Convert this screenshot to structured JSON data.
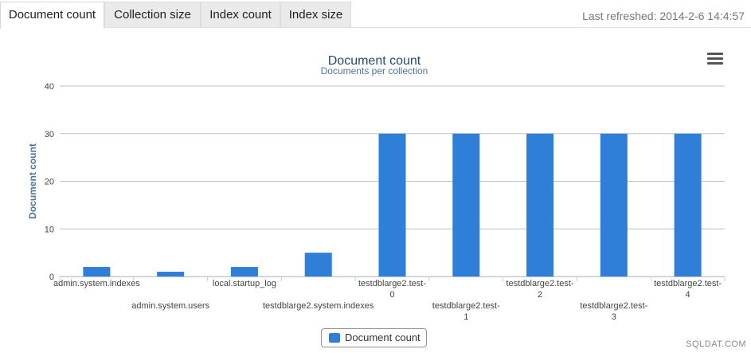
{
  "tabs": [
    {
      "label": "Document count",
      "active": true
    },
    {
      "label": "Collection size",
      "active": false
    },
    {
      "label": "Index count",
      "active": false
    },
    {
      "label": "Index size",
      "active": false
    }
  ],
  "refreshed_label": "Last refreshed: 2014-2-6 14:4:57",
  "menu_icon": "hamburger-menu-icon",
  "watermark": "SQLDAT.COM",
  "colors": {
    "series": "#2f7ed8",
    "title": "#274b6d",
    "subtitle": "#4d759e",
    "axis_title": "#4d759e"
  },
  "chart_data": {
    "type": "bar",
    "title": "Document count",
    "subtitle": "Documents per collection",
    "xlabel": "",
    "ylabel": "Document count",
    "ylim": [
      0,
      40
    ],
    "yticks": [
      0,
      10,
      20,
      30,
      40
    ],
    "grid": true,
    "legend_position": "bottom-center",
    "categories": [
      "admin.system.indexes",
      "admin.system.users",
      "local.startup_log",
      "testdblarge2.system.indexes",
      "testdblarge2.test-0",
      "testdblarge2.test-1",
      "testdblarge2.test-2",
      "testdblarge2.test-3",
      "testdblarge2.test-4"
    ],
    "category_label_lines": [
      [
        "admin.system.indexes"
      ],
      [
        "admin.system.users"
      ],
      [
        "local.startup_log"
      ],
      [
        "testdblarge2.system.indexes"
      ],
      [
        "testdblarge2.test-",
        "0"
      ],
      [
        "testdblarge2.test-",
        "1"
      ],
      [
        "testdblarge2.test-",
        "2"
      ],
      [
        "testdblarge2.test-",
        "3"
      ],
      [
        "testdblarge2.test-",
        "4"
      ]
    ],
    "series": [
      {
        "name": "Document count",
        "values": [
          2,
          1,
          2,
          5,
          30,
          30,
          30,
          30,
          30
        ]
      }
    ]
  }
}
